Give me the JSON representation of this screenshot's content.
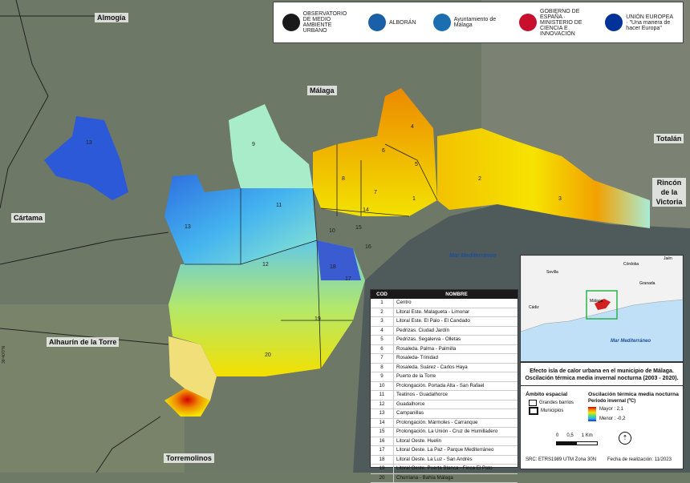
{
  "places": {
    "almogia": "Almogía",
    "malaga": "Málaga",
    "totalan": "Totalán",
    "rincon": "Rincón de la Victoria",
    "cartama": "Cártama",
    "alhaurin": "Alhaurín de la Torre",
    "torremolinos": "Torremolinos",
    "mar": "Mar Mediterráneo"
  },
  "logos": [
    {
      "name": "OBSERVATORIO DE MEDIO AMBIENTE URBANO",
      "color": "#1a1a1a"
    },
    {
      "name": "ALBORÁN",
      "color": "#1b5fa8"
    },
    {
      "name": "Ayuntamiento de Málaga",
      "color": "#1b6fb0"
    },
    {
      "name": "GOBIERNO DE ESPAÑA · MINISTERIO DE CIENCIA E INNOVACIÓN",
      "color": "#c8102e"
    },
    {
      "name": "UNIÓN EUROPEA · \"Una manera de hacer Europa\"",
      "color": "#003399"
    }
  ],
  "legend": {
    "col_cod": "COD",
    "col_name": "NOMBRE",
    "rows": [
      {
        "cod": "1",
        "name": "Centro"
      },
      {
        "cod": "2",
        "name": "Litoral Este. Malagueta - Limonar"
      },
      {
        "cod": "3",
        "name": "Litoral Este. El Palo - El Candado"
      },
      {
        "cod": "4",
        "name": "Pedrizas. Ciudad Jardín"
      },
      {
        "cod": "5",
        "name": "Pedrizas. Segalerva - Olletas"
      },
      {
        "cod": "6",
        "name": "Rosaleda. Palma - Palmilla"
      },
      {
        "cod": "7",
        "name": "Rosaleda- Trinidad"
      },
      {
        "cod": "8",
        "name": "Rosaleda. Suárez - Carlos Haya"
      },
      {
        "cod": "9",
        "name": "Puerto de la Torre"
      },
      {
        "cod": "10",
        "name": "Prolongación. Portada Alta - San Rafael"
      },
      {
        "cod": "11",
        "name": "Teatinos - Guadalhorce"
      },
      {
        "cod": "12",
        "name": "Guadalhorce"
      },
      {
        "cod": "13",
        "name": "Campanillas"
      },
      {
        "cod": "14",
        "name": "Prolongación. Mármoles - Carranque"
      },
      {
        "cod": "15",
        "name": "Prolongación. La Unión - Cruz de Humilladero"
      },
      {
        "cod": "16",
        "name": "Litoral Oeste. Huelin"
      },
      {
        "cod": "17",
        "name": "Litoral Oeste. La Paz - Parque Mediterráneo"
      },
      {
        "cod": "18",
        "name": "Litoral Oeste. La Luz - San Andrés"
      },
      {
        "cod": "19",
        "name": "Litoral Oeste. Puerta Blanca - Finca El Pato"
      },
      {
        "cod": "20",
        "name": "Churriana - Bahía Málaga"
      }
    ]
  },
  "inset": {
    "cities": [
      "Córdoba",
      "Jaén",
      "Sevilla",
      "Granada",
      "Cádiz",
      "Málaga"
    ],
    "sea": "Mar Mediterráneo"
  },
  "info": {
    "title": "Efecto isla de calor urbana en el municipio de Málaga. Oscilación térmica media invernal nocturna (2003 - 2020).",
    "ambito": "Ámbito espacial",
    "grandes": "Grandes barrios",
    "municipios": "Municipios",
    "osc_title": "Oscilación térmica media nocturna",
    "periodo": "Periodo invernal (ºC)",
    "mayor": "Mayor : 2,1",
    "menor": "Menor : -0,2",
    "scale": [
      "0",
      "0,5",
      "1 Km"
    ],
    "src": "SRC: ETRS1989 UTM Zona 30N",
    "fecha": "Fecha de realización: 11/2023"
  },
  "grid_tick": "36º40'0\"N",
  "colors": {
    "hot": "#d40000",
    "warm": "#f08a00",
    "mild": "#f4e400",
    "cool": "#59e07a",
    "cold": "#29b8ea",
    "coldest": "#1937c8",
    "sea": "#4f5b5a"
  }
}
